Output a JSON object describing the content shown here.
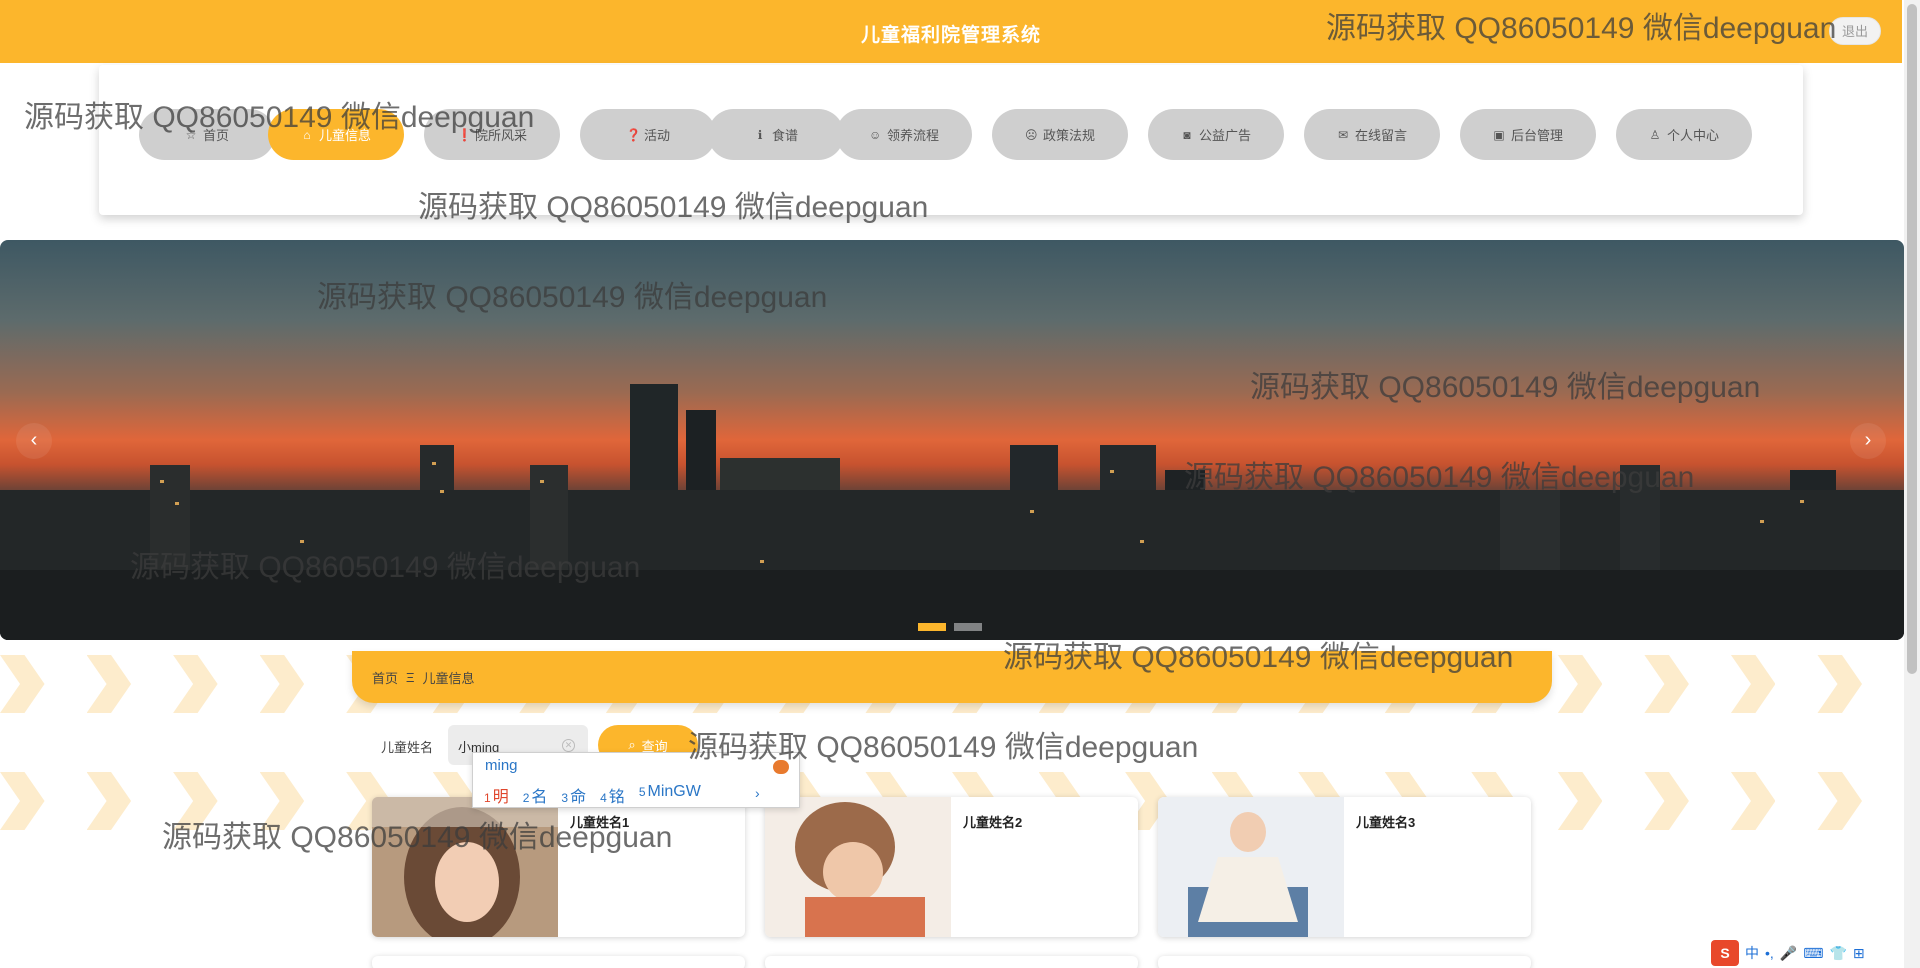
{
  "header": {
    "title": "儿童福利院管理系统",
    "logout_label": "退出"
  },
  "nav": {
    "items": [
      {
        "label": "首页",
        "icon": "☆"
      },
      {
        "label": "儿童信息",
        "icon": "⌂"
      },
      {
        "label": "院所风采",
        "icon": "❗"
      },
      {
        "label": "活动",
        "icon": "❓"
      },
      {
        "label": "食谱",
        "icon": "ℹ"
      },
      {
        "label": "领养流程",
        "icon": "☺"
      },
      {
        "label": "政策法规",
        "icon": "☹"
      },
      {
        "label": "公益广告",
        "icon": "◙"
      },
      {
        "label": "在线留言",
        "icon": "✉"
      },
      {
        "label": "后台管理",
        "icon": "▣"
      },
      {
        "label": "个人中心",
        "icon": "♙"
      }
    ],
    "active_index": 1
  },
  "banner": {
    "prev_icon": "‹",
    "next_icon": "›",
    "slide_count": 2,
    "active_slide": 0
  },
  "breadcrumb": {
    "home": "首页",
    "separator": "Ξ",
    "current": "儿童信息"
  },
  "search": {
    "label": "儿童姓名",
    "value": "小ming",
    "button_label": "查询",
    "clear_icon": "✕",
    "button_icon": "⌕"
  },
  "ime": {
    "composition": "ming",
    "candidates": [
      {
        "n": "1",
        "text": "明"
      },
      {
        "n": "2",
        "text": "名"
      },
      {
        "n": "3",
        "text": "命"
      },
      {
        "n": "4",
        "text": "铭"
      },
      {
        "n": "5",
        "text": "MinGW"
      }
    ],
    "more_icon": "›"
  },
  "children": [
    {
      "name": "儿童姓名1"
    },
    {
      "name": "儿童姓名2"
    },
    {
      "name": "儿童姓名3"
    }
  ],
  "watermark": "源码获取 QQ86050149 微信deepguan",
  "tray": {
    "logo": "S",
    "lang": "中",
    "items": [
      "•,",
      "🎤",
      "⌨",
      "👕",
      "⊞"
    ]
  },
  "colors": {
    "primary": "#fcb62c",
    "nav_inactive": "#cfcfcf",
    "ime_text": "#2a76c6"
  }
}
